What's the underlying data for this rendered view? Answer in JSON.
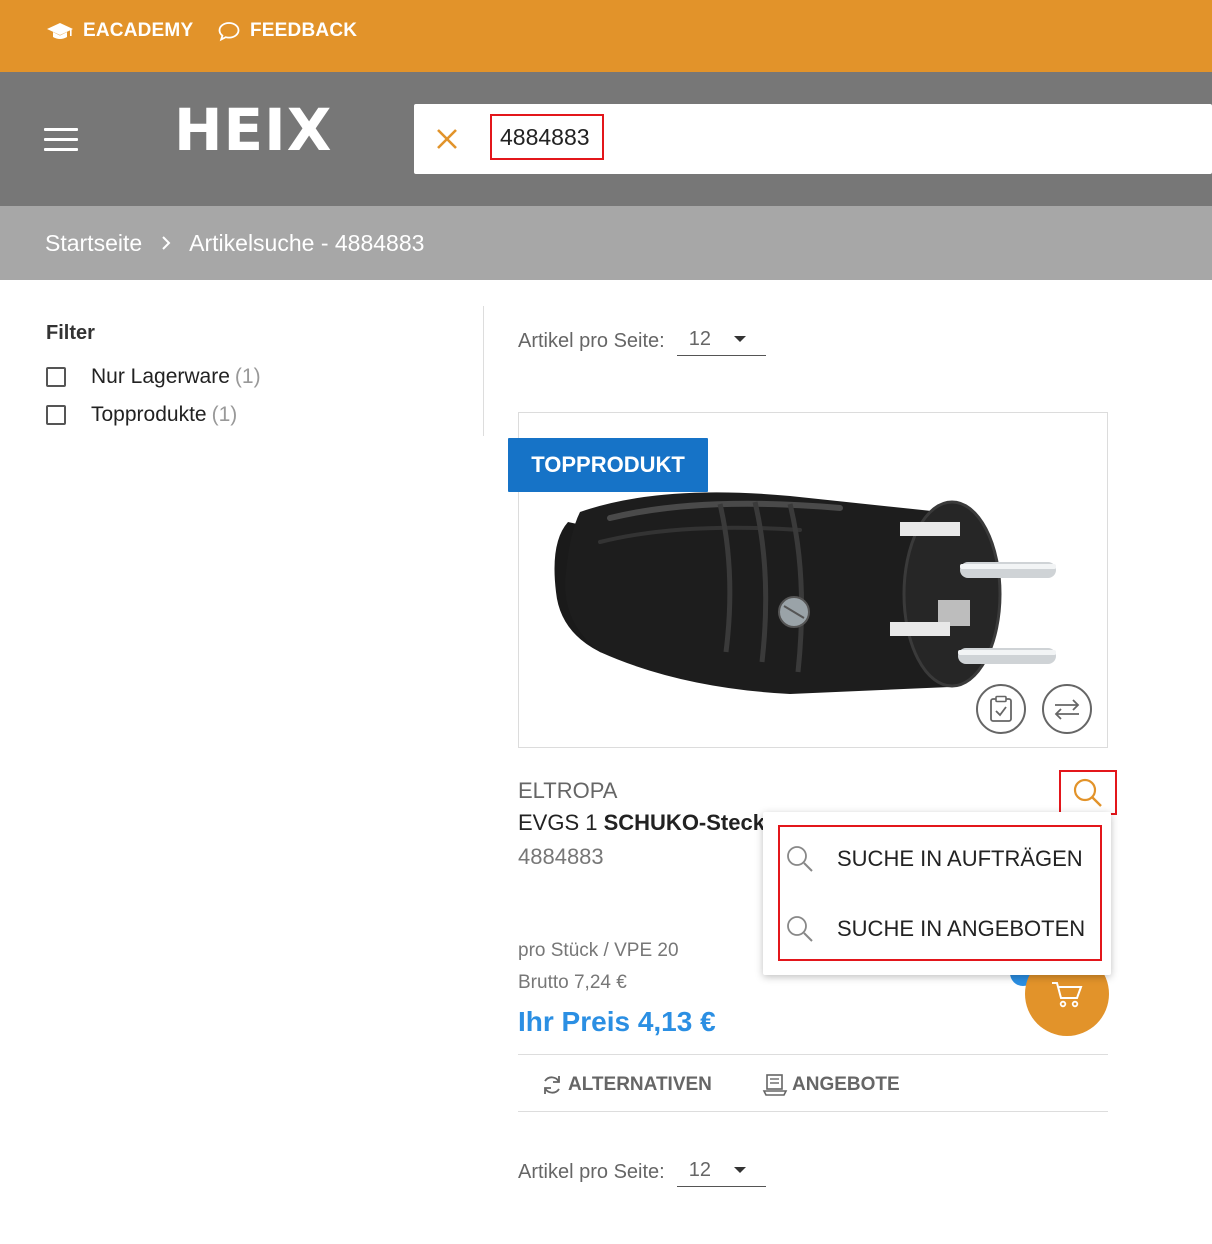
{
  "topbar": {
    "academy_label": "EACADEMY",
    "feedback_label": "FEEDBACK",
    "color": "#e2932a"
  },
  "header": {
    "logo": "HEIX",
    "search_value": "4884883"
  },
  "breadcrumb": {
    "home": "Startseite",
    "current": "Artikelsuche - 4884883"
  },
  "filter": {
    "title": "Filter",
    "items": [
      {
        "label": "Nur Lagerware",
        "count": "(1)"
      },
      {
        "label": "Topprodukte",
        "count": "(1)"
      }
    ]
  },
  "paging": {
    "label": "Artikel pro Seite:",
    "value": "12"
  },
  "product": {
    "badge": "TOPPRODUKT",
    "brand": "ELTROPA",
    "name_prefix": "EVGS 1 ",
    "name_bold": "SCHUKO-Steck",
    "number": "4884883",
    "unit": "pro Stück  / VPE 20",
    "gross": "Brutto 7,24 €",
    "price": "Ihr Preis 4,13 €"
  },
  "search_menu": {
    "items": [
      "SUCHE IN AUFTRÄGEN",
      "SUCHE IN ANGEBOTEN"
    ]
  },
  "actions": {
    "alternatives": "ALTERNATIVEN",
    "offers": "ANGEBOTE"
  },
  "colors": {
    "accent": "#e2932a",
    "header_gray": "#777777",
    "breadcrumb_gray": "#a7a7a7",
    "badge_blue": "#1673c7",
    "price_blue": "#2b8fe3",
    "highlight_red": "#e3161b"
  }
}
